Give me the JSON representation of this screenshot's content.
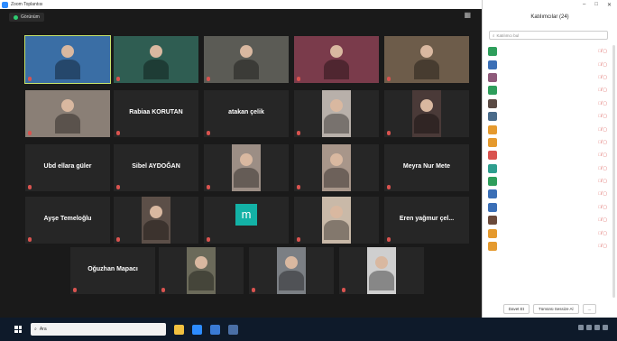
{
  "window": {
    "title": "Zoom Toplantısı"
  },
  "topbar": {
    "view_label": "Görünüm"
  },
  "tiles": [
    {
      "name": "",
      "big": "",
      "type": "photo",
      "active": true,
      "bg": "#3a6ea5"
    },
    {
      "name": "",
      "big": "",
      "type": "photo",
      "bg": "#2f5d52"
    },
    {
      "name": "",
      "big": "",
      "type": "photo",
      "bg": "#5b5b55"
    },
    {
      "name": "",
      "big": "",
      "type": "photo",
      "bg": "#7a3b4b"
    },
    {
      "name": "",
      "big": "",
      "type": "photo",
      "bg": "#6d5c4a"
    },
    {
      "name": "",
      "big": "",
      "type": "photo",
      "bg": "#8a7f76"
    },
    {
      "name": "",
      "big": "Rabiaa KORUTAN",
      "type": "text"
    },
    {
      "name": "",
      "big": "atakan çelik",
      "type": "text"
    },
    {
      "name": "",
      "big": "",
      "type": "photo",
      "bg": "#b8b0aa"
    },
    {
      "name": "",
      "big": "",
      "type": "photo",
      "bg": "#4a3a38"
    },
    {
      "name": "",
      "big": "Ubd ellara güler",
      "type": "text"
    },
    {
      "name": "",
      "big": "Sibel AYDOĞAN",
      "type": "text"
    },
    {
      "name": "",
      "big": "",
      "type": "photo",
      "bg": "#9c8e85"
    },
    {
      "name": "",
      "big": "",
      "type": "photo",
      "bg": "#a8968a"
    },
    {
      "name": "",
      "big": "Meyra Nur Mete",
      "type": "text"
    },
    {
      "name": "",
      "big": "Ayşe Temeloğlu",
      "type": "text"
    },
    {
      "name": "",
      "big": "",
      "type": "photo",
      "bg": "#5c4f48"
    },
    {
      "name": "",
      "big": "m",
      "type": "letter"
    },
    {
      "name": "",
      "big": "",
      "type": "photo",
      "bg": "#c9b9a8"
    },
    {
      "name": "",
      "big": "Eren yağmur çel...",
      "type": "text"
    },
    {
      "name": "",
      "big": "Oğuzhan Mapacı",
      "type": "text"
    },
    {
      "name": "",
      "big": "",
      "type": "photo",
      "bg": "#6b6a5a"
    },
    {
      "name": "",
      "big": "",
      "type": "photo",
      "bg": "#7b7f84"
    },
    {
      "name": "",
      "big": "",
      "type": "photo",
      "bg": "#cfcfcf"
    }
  ],
  "taskbar": {
    "search_placeholder": "Ara",
    "time": "",
    "date": ""
  },
  "panel": {
    "title": "Katılımcılar (24)",
    "search_placeholder": "Katılımcı bul",
    "participants": [
      {
        "name": "",
        "color": "#2e9e5b"
      },
      {
        "name": "",
        "color": "#3b6fb6"
      },
      {
        "name": "",
        "color": "#8e5a7a"
      },
      {
        "name": "",
        "color": "#2e9e5b"
      },
      {
        "name": "",
        "color": "#5b4b44"
      },
      {
        "name": "",
        "color": "#4a6b8a"
      },
      {
        "name": "",
        "color": "#e59a2e"
      },
      {
        "name": "",
        "color": "#e59a2e"
      },
      {
        "name": "",
        "color": "#d9534f"
      },
      {
        "name": "",
        "color": "#2e9e8e"
      },
      {
        "name": "",
        "color": "#2e9e5b"
      },
      {
        "name": "",
        "color": "#3b6fb6"
      },
      {
        "name": "",
        "color": "#3b6fb6"
      },
      {
        "name": "",
        "color": "#6b4a3a"
      },
      {
        "name": "",
        "color": "#e59a2e"
      },
      {
        "name": "",
        "color": "#e59a2e"
      }
    ],
    "buttons": [
      "Davet Et",
      "Tümünü Sessize Al",
      "..."
    ]
  }
}
